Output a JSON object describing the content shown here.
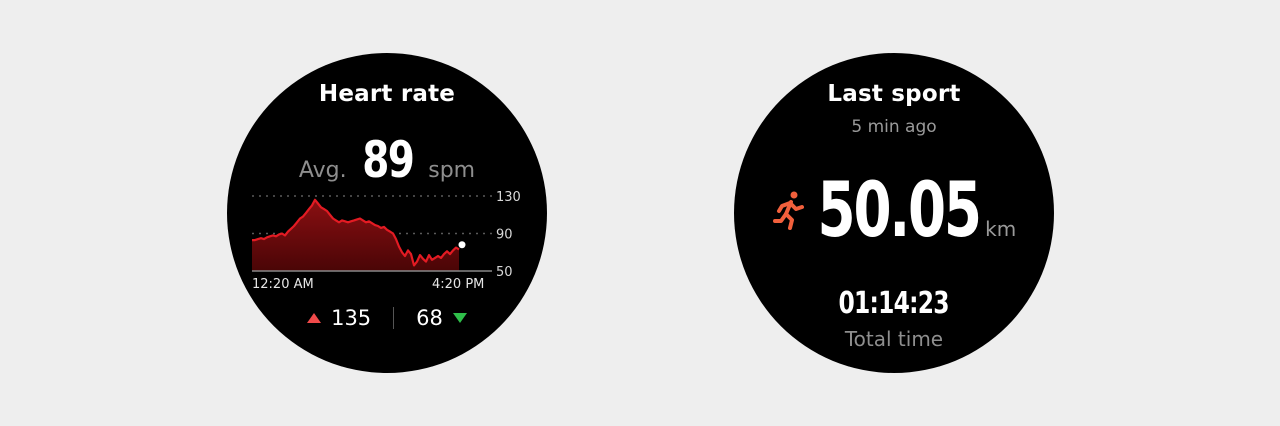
{
  "heart_rate": {
    "title": "Heart rate",
    "avg_label": "Avg.",
    "avg_value": "89",
    "unit": "spm",
    "y_ticks": [
      "130",
      "90",
      "50"
    ],
    "time_start": "12:20 AM",
    "time_end": "4:20 PM",
    "max_value": "135",
    "min_value": "68",
    "accent_color": "#e31b23"
  },
  "last_sport": {
    "title": "Last sport",
    "subtitle": "5 min ago",
    "icon": "running-icon",
    "distance": "50.05",
    "distance_unit": "km",
    "duration": "01:14:23",
    "duration_label": "Total time",
    "accent_color": "#f2603c"
  },
  "chart_data": {
    "type": "area",
    "ylim": [
      50,
      130
    ],
    "y_ticks": [
      130,
      90,
      50
    ],
    "x_labels": [
      "12:20 AM",
      "4:20 PM"
    ],
    "values": [
      83,
      83,
      84,
      85,
      84,
      86,
      87,
      88,
      87,
      89,
      90,
      88,
      92,
      95,
      98,
      102,
      106,
      108,
      112,
      116,
      120,
      126,
      122,
      118,
      116,
      114,
      110,
      106,
      104,
      102,
      104,
      103,
      102,
      103,
      104,
      105,
      106,
      104,
      102,
      103,
      101,
      99,
      98,
      96,
      97,
      94,
      92,
      90,
      84,
      76,
      70,
      66,
      72,
      68,
      56,
      60,
      67,
      63,
      60,
      67,
      62,
      64,
      66,
      64,
      68,
      71,
      68,
      72,
      75,
      73
    ],
    "marker_value": 78
  }
}
